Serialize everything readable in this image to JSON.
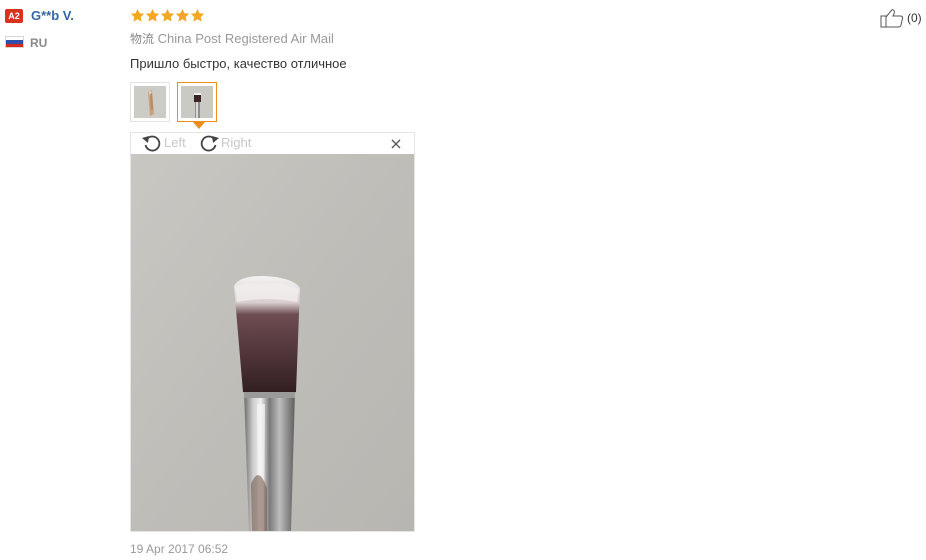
{
  "buyer": {
    "level_badge": "A2",
    "name": "G**b V.",
    "country_code": "RU",
    "flag_icon": "russia-flag-icon"
  },
  "review": {
    "rating": 5,
    "rating_max": 5,
    "star_color": "#f5a623",
    "logistics_label": "物流",
    "logistics_value": "China Post Registered Air Mail",
    "text": "Пришло быстро, качество отлично​е",
    "thumbnails": [
      {
        "name": "review-photo-1",
        "selected": false
      },
      {
        "name": "review-photo-2",
        "selected": true
      }
    ],
    "date": "19 Apr 2017 06:52"
  },
  "viewer": {
    "rotate_left_label": "Left",
    "rotate_right_label": "Right",
    "close_glyph": "×"
  },
  "helpful": {
    "icon": "thumbs-up-icon",
    "count_text": "(0)"
  },
  "colors": {
    "accent_orange": "#f08c1a",
    "badge_red": "#d9321f",
    "name_blue": "#3366a6"
  }
}
